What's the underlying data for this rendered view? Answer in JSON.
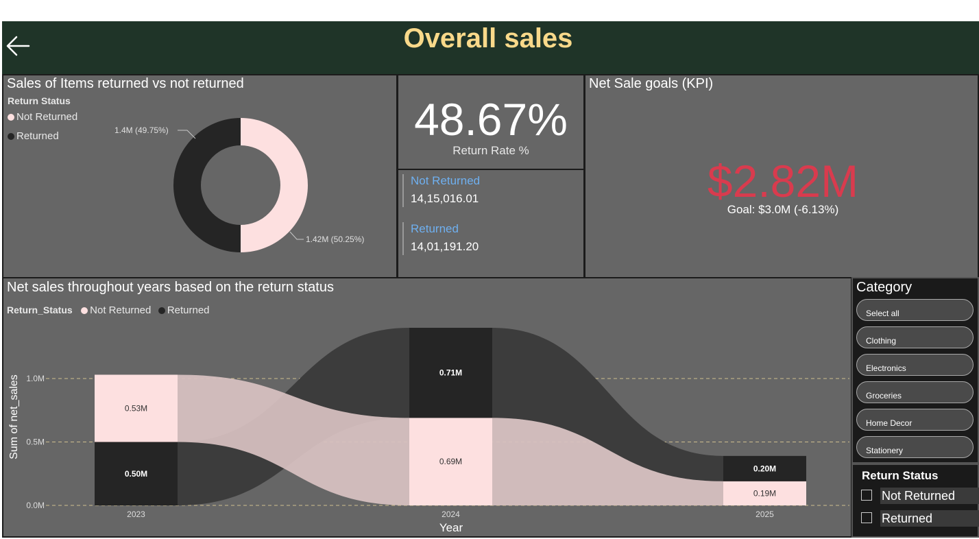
{
  "header": {
    "title": "Overall sales",
    "back_icon": "arrow-left-icon"
  },
  "donut_panel": {
    "title": "Sales of Items returned vs not returned",
    "legend_title": "Return Status",
    "legend_items": [
      {
        "label": "Not Returned",
        "color": "#fde0e0"
      },
      {
        "label": "Returned",
        "color": "#252525"
      }
    ],
    "label_returned": "1.4M (49.75%)",
    "label_not_returned": "1.42M (50.25%)"
  },
  "return_rate_card": {
    "value": "48.67%",
    "caption": "Return Rate %"
  },
  "multi_card": {
    "items": [
      {
        "label": "Not Returned",
        "value": "14,15,016.01"
      },
      {
        "label": "Returned",
        "value": "14,01,191.20"
      }
    ]
  },
  "kpi_panel": {
    "title": "Net Sale goals (KPI)",
    "value": "$2.82M",
    "goal_text": "Goal: $3.0M (-6.13%)",
    "value_color": "#d93b4e"
  },
  "ribbon_panel": {
    "title": "Net sales throughout years based on the return status",
    "legend_title": "Return_Status",
    "legend_items": [
      {
        "label": "Not Returned",
        "color": "#fde0e0"
      },
      {
        "label": "Returned",
        "color": "#252525"
      }
    ]
  },
  "chart_data": {
    "type": "bar",
    "subtype": "ribbon",
    "title": "Net sales throughout years based on the return status",
    "xlabel": "Year",
    "ylabel": "Sum of net_sales",
    "categories": [
      "2023",
      "2024",
      "2025"
    ],
    "y_ticks": [
      "0.0M",
      "0.5M",
      "1.0M"
    ],
    "ylim": [
      0,
      1.0
    ],
    "gridlines": true,
    "series": [
      {
        "name": "Not Returned",
        "values": [
          0.53,
          0.69,
          0.19
        ],
        "labels": [
          "0.53M",
          "0.69M",
          "0.19M"
        ],
        "color": "#fde0e0"
      },
      {
        "name": "Returned",
        "values": [
          0.5,
          0.71,
          0.2
        ],
        "labels": [
          "0.50M",
          "0.71M",
          "0.20M"
        ],
        "color": "#252525"
      }
    ],
    "stack_order_by_year": [
      [
        "Returned",
        "Not Returned"
      ],
      [
        "Not Returned",
        "Returned"
      ],
      [
        "Not Returned",
        "Returned"
      ]
    ]
  },
  "category_slicer": {
    "title": "Category",
    "options": [
      "Select all",
      "Clothing",
      "Electronics",
      "Groceries",
      "Home Decor",
      "Stationery"
    ]
  },
  "return_status_slicer": {
    "title": "Return Status",
    "options": [
      "Not Returned",
      "Returned"
    ]
  }
}
